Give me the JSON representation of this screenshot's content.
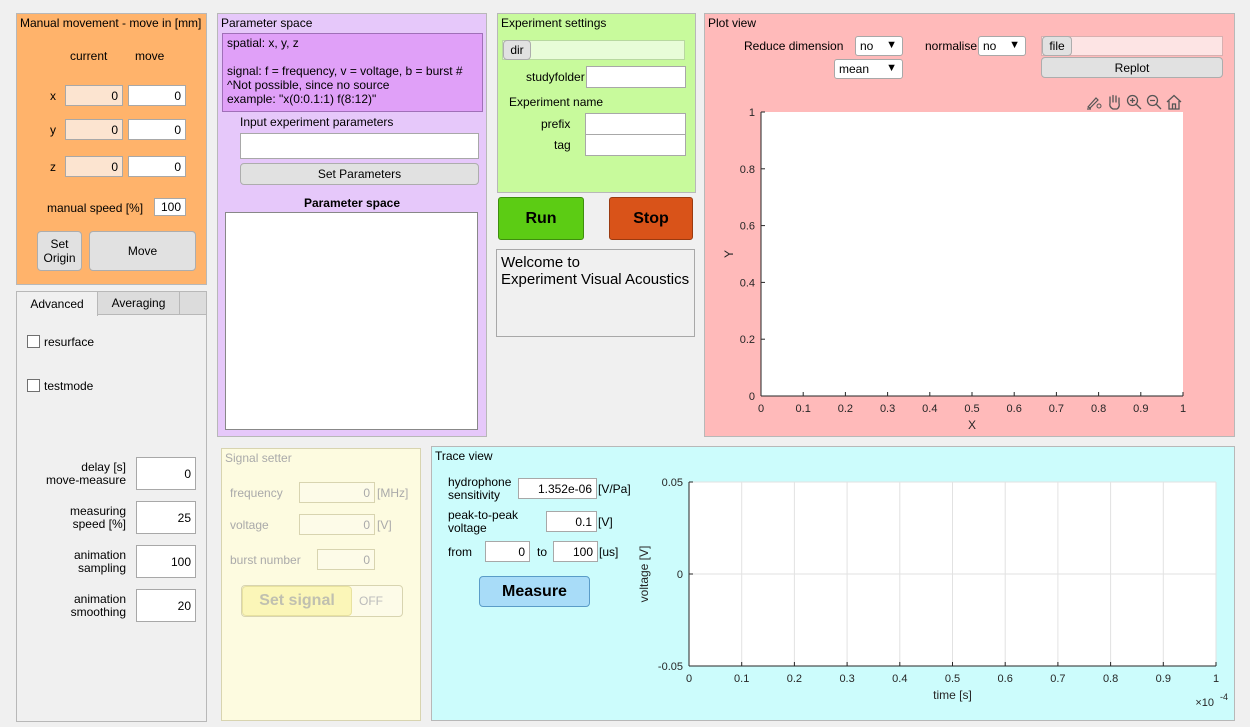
{
  "manual": {
    "title": "Manual movement - move in [mm]",
    "col_current": "current",
    "col_move": "move",
    "axes": [
      {
        "label": "x",
        "current": "0",
        "move": "0"
      },
      {
        "label": "y",
        "current": "0",
        "move": "0"
      },
      {
        "label": "z",
        "current": "0",
        "move": "0"
      }
    ],
    "speed_label": "manual speed [%]",
    "speed_value": "100",
    "set_origin_label": "Set\nOrigin",
    "move_label": "Move"
  },
  "tabs": {
    "items": [
      "Advanced",
      "Averaging"
    ],
    "active": "Advanced",
    "resurface_label": "resurface",
    "testmode_label": "testmode",
    "delay_label": "delay [s]\nmove-measure",
    "delay_value": "0",
    "mspeed_label": "measuring\nspeed [%]",
    "mspeed_value": "25",
    "asampling_label": "animation\nsampling",
    "asampling_value": "100",
    "asmoothing_label": "animation\nsmoothing",
    "asmoothing_value": "20"
  },
  "param": {
    "title": "Parameter space",
    "help_lines": [
      "spatial: x, y, z",
      "",
      "signal: f = frequency, v = voltage, b = burst #",
      "^Not possible, since no source",
      "example: \"x(0:0.1:1) f(8:12)\""
    ],
    "input_label": "Input experiment parameters",
    "input_value": "",
    "set_button": "Set Parameters",
    "list_title": "Parameter space"
  },
  "experiment": {
    "title": "Experiment settings",
    "dir_button": "dir",
    "dir_value": "",
    "studyfolder_label": "studyfolder",
    "studyfolder_value": "",
    "name_label": "Experiment name",
    "prefix_label": "prefix",
    "prefix_value": "",
    "tag_label": "tag",
    "tag_value": "",
    "run_label": "Run",
    "stop_label": "Stop",
    "welcome_text": "Welcome to\nExperiment Visual Acoustics"
  },
  "plot": {
    "title": "Plot view",
    "reduce_label": "Reduce dimension",
    "reduce_value": "no",
    "reduce_method": "mean",
    "normalise_label": "normalise",
    "normalise_value": "no",
    "file_button": "file",
    "file_value": "",
    "replot_label": "Replot",
    "toolbar_icons": [
      "brush-icon",
      "pan-hand-icon",
      "zoom-in-icon",
      "zoom-out-icon",
      "home-icon"
    ]
  },
  "signal": {
    "title": "Signal setter",
    "frequency_label": "frequency",
    "frequency_value": "0",
    "frequency_unit": "[MHz]",
    "voltage_label": "voltage",
    "voltage_value": "0",
    "voltage_unit": "[V]",
    "burst_label": "burst number",
    "burst_value": "0",
    "set_signal_label": "Set signal",
    "toggle_label": "OFF"
  },
  "trace": {
    "title": "Trace view",
    "hydro_label": "hydrophone\nsensitivity",
    "hydro_value": "1.352e-06",
    "hydro_unit": "[V/Pa]",
    "p2p_label": "peak-to-peak\nvoltage",
    "p2p_value": "0.1",
    "p2p_unit": "[V]",
    "from_label": "from",
    "from_value": "0",
    "to_label": "to",
    "to_value": "100",
    "range_unit": "[us]",
    "measure_label": "Measure"
  },
  "colors": {
    "manual_bg": "#ffb36b",
    "param_bg": "#e6c8fa",
    "param_help_bg": "#e0a0f8",
    "experiment_bg": "#c8fa9c",
    "plot_bg": "#ffbaba",
    "trace_bg": "#ccfcfc",
    "signal_bg": "#fdfbe0",
    "run": "#5ccc14",
    "stop": "#d95319",
    "measure": "#a8dcf8"
  },
  "chart_data": [
    {
      "type": "line",
      "title": "",
      "xlabel": "X",
      "ylabel": "Y",
      "xlim": [
        0,
        1
      ],
      "ylim": [
        0,
        1
      ],
      "xticks": [
        0,
        0.1,
        0.2,
        0.3,
        0.4,
        0.5,
        0.6,
        0.7,
        0.8,
        0.9,
        1
      ],
      "xtick_labels": [
        "0",
        "0.1",
        "0.2",
        "0.3",
        "0.4",
        "0.5",
        "0.6",
        "0.7",
        "0.8",
        "0.9",
        "1"
      ],
      "yticks": [
        0,
        0.2,
        0.4,
        0.6,
        0.8,
        1
      ],
      "ytick_labels": [
        "0",
        "0.2",
        "0.4",
        "0.6",
        "0.8",
        "1"
      ],
      "grid": false,
      "series": []
    },
    {
      "type": "line",
      "title": "",
      "xlabel": "time [s]",
      "ylabel": "voltage [V]",
      "xlim": [
        0,
        0.0001
      ],
      "ylim": [
        -0.05,
        0.05
      ],
      "xticks": [
        0,
        1e-05,
        2e-05,
        3e-05,
        4e-05,
        5e-05,
        6e-05,
        7e-05,
        8e-05,
        9e-05,
        0.0001
      ],
      "xtick_labels": [
        "0",
        "0.1",
        "0.2",
        "0.3",
        "0.4",
        "0.5",
        "0.6",
        "0.7",
        "0.8",
        "0.9",
        "1"
      ],
      "x_exponent_label": "×10",
      "x_exponent_power": "-4",
      "yticks": [
        -0.05,
        0,
        0.05
      ],
      "ytick_labels": [
        "-0.05",
        "0",
        "0.05"
      ],
      "grid": true,
      "series": []
    }
  ]
}
